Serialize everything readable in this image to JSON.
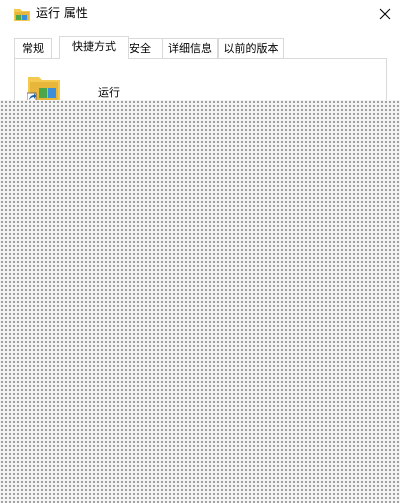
{
  "window": {
    "title": "运行 属性",
    "close_icon": "close-icon",
    "title_icon": "folder-shortcut-icon"
  },
  "tabs": [
    {
      "label": "常规",
      "active": false
    },
    {
      "label": "快捷方式",
      "active": true
    },
    {
      "label": "安全",
      "active": false
    },
    {
      "label": "详细信息",
      "active": false
    },
    {
      "label": "以前的版本",
      "active": false
    }
  ],
  "shortcut": {
    "name": "运行",
    "icon": "folder-shortcut-icon"
  },
  "colors": {
    "tab_border": "#d9d9d9",
    "folder_yellow": "#f3c94f",
    "folder_green": "#4aa84a",
    "folder_blue": "#3c8ed8"
  }
}
